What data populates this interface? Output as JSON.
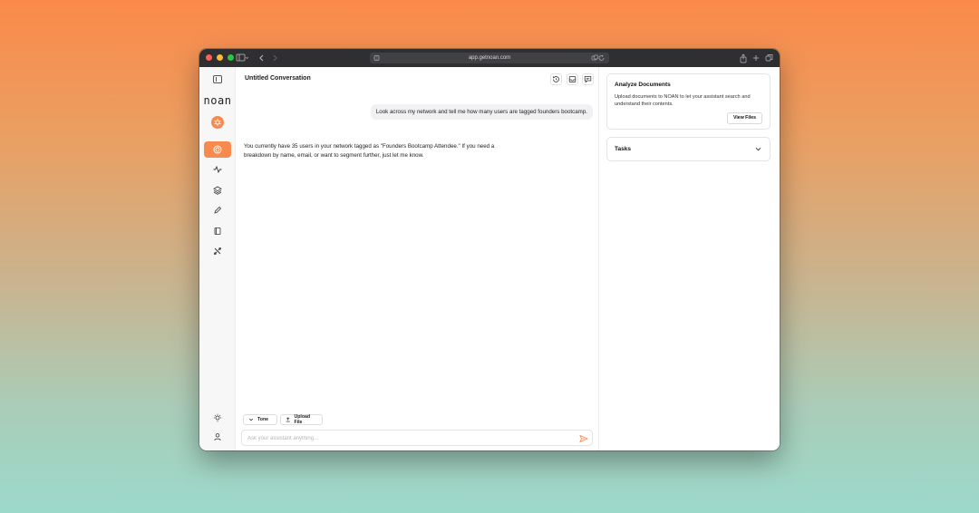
{
  "browser": {
    "url": "app.getnoan.com",
    "traffic_lights": [
      "#ff5f57",
      "#febc2e",
      "#28c840"
    ]
  },
  "sidebar": {
    "logo": "noan",
    "avatar_icon": "spark-icon",
    "items": [
      {
        "name": "assistant",
        "icon": "target-icon",
        "active": true
      },
      {
        "name": "activity",
        "icon": "pulse-icon",
        "active": false
      },
      {
        "name": "layers",
        "icon": "layers-icon",
        "active": false
      },
      {
        "name": "edit",
        "icon": "pencil-icon",
        "active": false
      },
      {
        "name": "library",
        "icon": "book-icon",
        "active": false
      },
      {
        "name": "tools",
        "icon": "tools-icon",
        "active": false
      }
    ],
    "bottom": [
      {
        "name": "ideas",
        "icon": "lightbulb-icon"
      },
      {
        "name": "account",
        "icon": "user-icon"
      }
    ]
  },
  "conversation": {
    "title": "Untitled Conversation",
    "header_actions": [
      "history-icon",
      "inbox-icon",
      "chat-icon"
    ],
    "messages": [
      {
        "role": "user",
        "text": "Look across my network and tell me how many users are tagged founders bootcamp."
      },
      {
        "role": "assistant",
        "text": "You currently have 35 users in your network tagged as \"Founders Bootcamp Attendee.\" If you need a breakdown by name, email, or want to segment further, just let me know."
      }
    ],
    "tone_label": "Tone",
    "upload_label": "Upload File",
    "input_placeholder": "Ask your assistant anything..."
  },
  "right_panel": {
    "analyze": {
      "title": "Analyze Documents",
      "description": "Upload documents to NOAN to let your assistant search and understand their contents.",
      "button": "View Files"
    },
    "tasks": {
      "title": "Tasks"
    }
  },
  "colors": {
    "accent": "#f88a4e"
  }
}
